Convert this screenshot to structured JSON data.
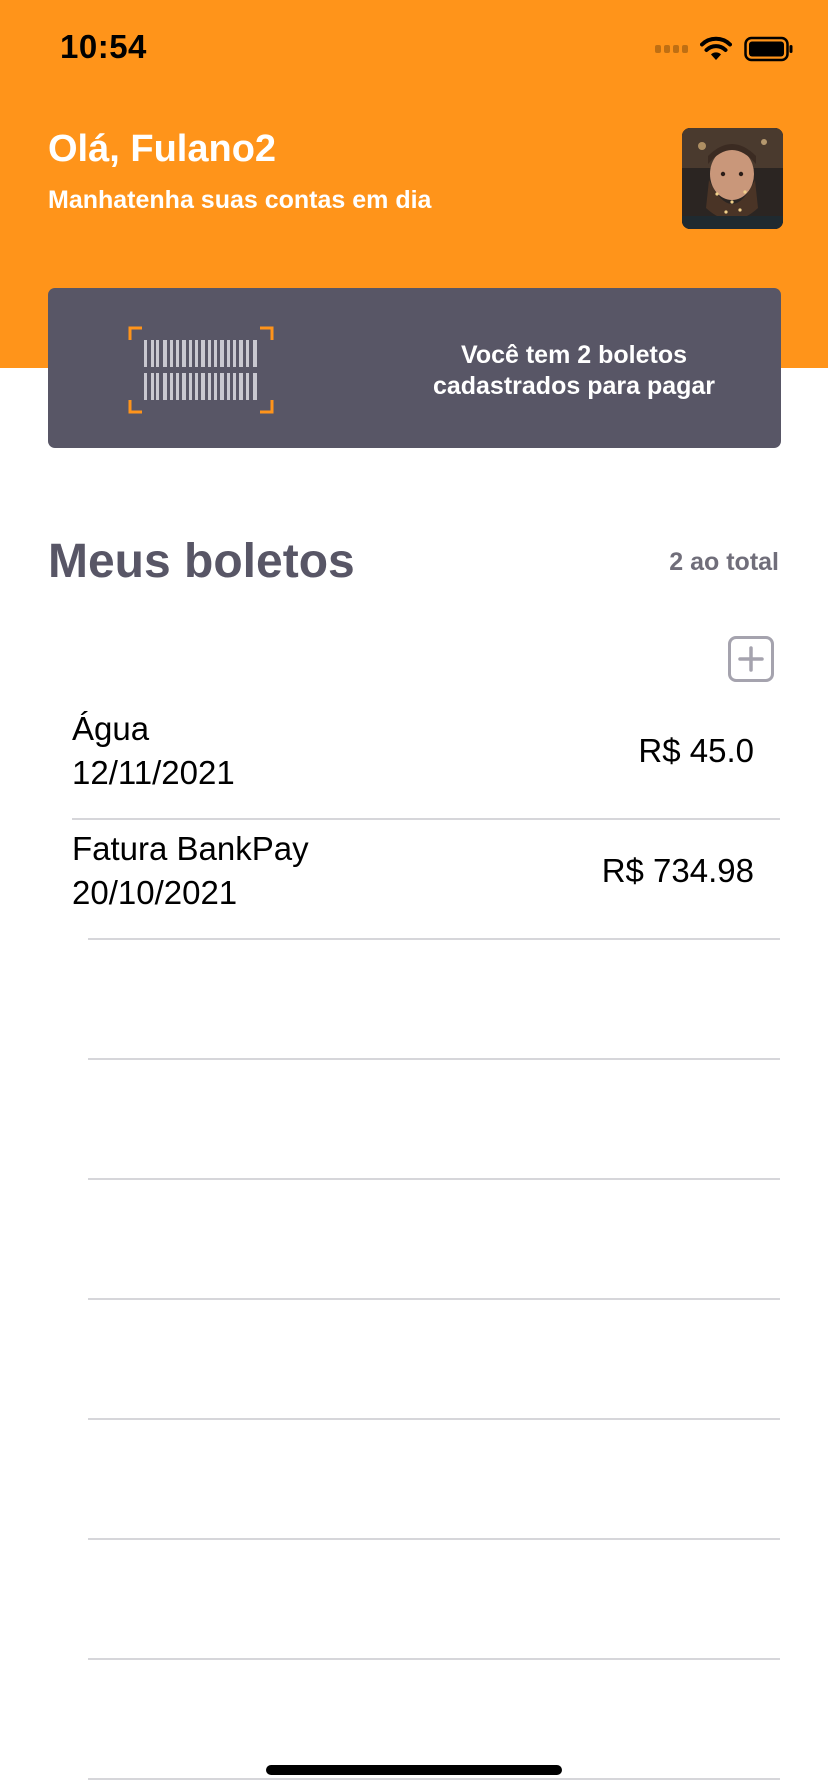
{
  "status_bar": {
    "time": "10:54"
  },
  "header": {
    "greeting": "Olá, Fulano2",
    "subtitle": "Manhatenha suas contas em dia"
  },
  "card": {
    "text": "Você tem 2 boletos cadastrados para pagar",
    "icon": "barcode-scan-icon"
  },
  "section": {
    "title": "Meus boletos",
    "count": "2 ao total",
    "add_icon": "plus-square-icon"
  },
  "boletos": [
    {
      "name": "Água",
      "date": "12/11/2021",
      "value": "R$ 45.0"
    },
    {
      "name": "Fatura BankPay",
      "date": "20/10/2021",
      "value": "R$ 734.98"
    }
  ],
  "colors": {
    "header": "#FF941A",
    "card": "#585666",
    "title": "#585666",
    "accent": "#FF941A"
  }
}
